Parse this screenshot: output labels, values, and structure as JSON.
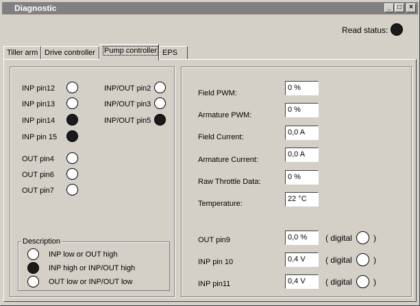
{
  "window": {
    "title": "Diagnostic"
  },
  "titlebar_buttons": {
    "minimize": "_",
    "maximize": "□",
    "close": "×"
  },
  "read_status": {
    "label": "Read status:",
    "on": true
  },
  "tabs": [
    {
      "label": "Tiller arm",
      "active": false
    },
    {
      "label": "Drive controller",
      "active": false
    },
    {
      "label": "Pump controller",
      "active": true
    },
    {
      "label": "EPS",
      "active": false
    }
  ],
  "pins_left": [
    {
      "label": "INP pin12",
      "on": false
    },
    {
      "label": "INP pin13",
      "on": false
    },
    {
      "label": "INP pin14",
      "on": true
    },
    {
      "label": "INP pin 15",
      "on": true
    },
    {
      "label": "OUT pin4",
      "on": false
    },
    {
      "label": "OUT pin6",
      "on": false
    },
    {
      "label": "OUT pin7",
      "on": false
    }
  ],
  "pins_right": [
    {
      "label": "INP/OUT pin2",
      "on": false
    },
    {
      "label": "INP/OUT pin3",
      "on": false
    },
    {
      "label": "INP/OUT pin5",
      "on": true
    }
  ],
  "description": {
    "title": "Description",
    "items": [
      {
        "text": "INP low  or  OUT high",
        "on": false
      },
      {
        "text": "INP high  or  INP/OUT high",
        "on": true
      },
      {
        "text": "OUT low or  INP/OUT low",
        "on": false
      }
    ]
  },
  "readings": [
    {
      "label": "Field PWM:",
      "value": "0 %"
    },
    {
      "label": "Armature PWM:",
      "value": "0 %"
    },
    {
      "label": "Field Current:",
      "value": "0,0 A"
    },
    {
      "label": "Armature Current:",
      "value": "0,0 A"
    },
    {
      "label": "Raw Throttle Data:",
      "value": "0 %"
    },
    {
      "label": "Temperature:",
      "value": "22 °C"
    }
  ],
  "analog_pins": [
    {
      "label": "OUT pin9",
      "value": "0,0 %",
      "digital_text": "( digital",
      "close": ")"
    },
    {
      "label": "INP pin 10",
      "value": "0,4 V",
      "digital_text": "( digital",
      "close": ")"
    },
    {
      "label": "INP pin11",
      "value": "0,4 V",
      "digital_text": "( digital",
      "close": ")"
    }
  ]
}
